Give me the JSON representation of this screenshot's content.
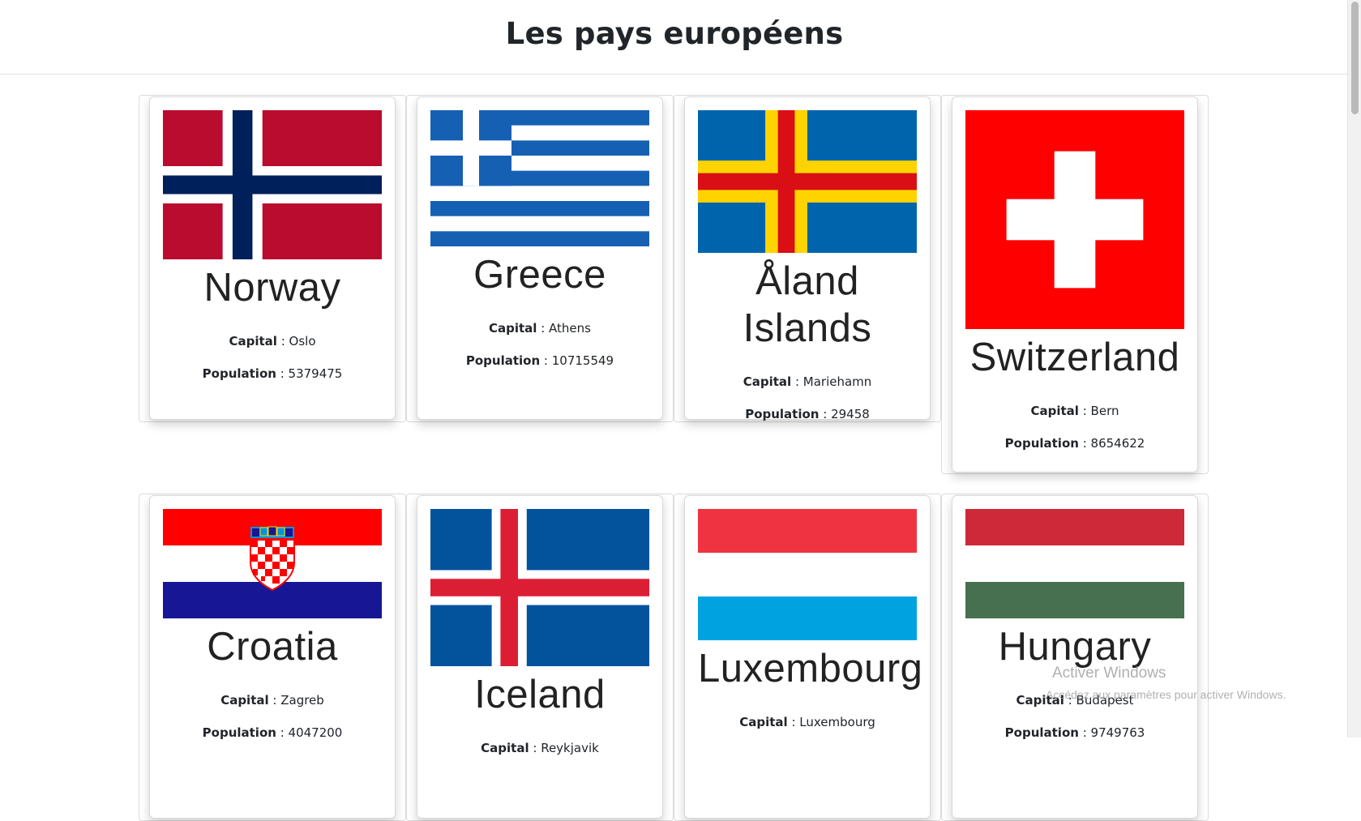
{
  "header": {
    "title": "Les pays européens"
  },
  "labels": {
    "capital": "Capital",
    "population": "Population",
    "separator": " : "
  },
  "countries": [
    {
      "name": "Norway",
      "capital": "Oslo",
      "population": "5379475",
      "flag_icon": "norway-flag"
    },
    {
      "name": "Greece",
      "capital": "Athens",
      "population": "10715549",
      "flag_icon": "greece-flag"
    },
    {
      "name": "Åland Islands",
      "capital": "Mariehamn",
      "population": "29458",
      "flag_icon": "aland-islands-flag"
    },
    {
      "name": "Switzerland",
      "capital": "Bern",
      "population": "8654622",
      "flag_icon": "switzerland-flag"
    },
    {
      "name": "Croatia",
      "capital": "Zagreb",
      "population": "4047200",
      "flag_icon": "croatia-flag"
    },
    {
      "name": "Iceland",
      "capital": "Reykjavik",
      "population": "",
      "flag_icon": "iceland-flag"
    },
    {
      "name": "Luxembourg",
      "capital": "Luxembourg",
      "population": "",
      "flag_icon": "luxembourg-flag"
    },
    {
      "name": "Hungary",
      "capital": "Budapest",
      "population": "9749763",
      "flag_icon": "hungary-flag"
    }
  ],
  "watermark": {
    "title": "Activer Windows",
    "subtitle": "Accédez aux paramètres pour activer Windows."
  }
}
